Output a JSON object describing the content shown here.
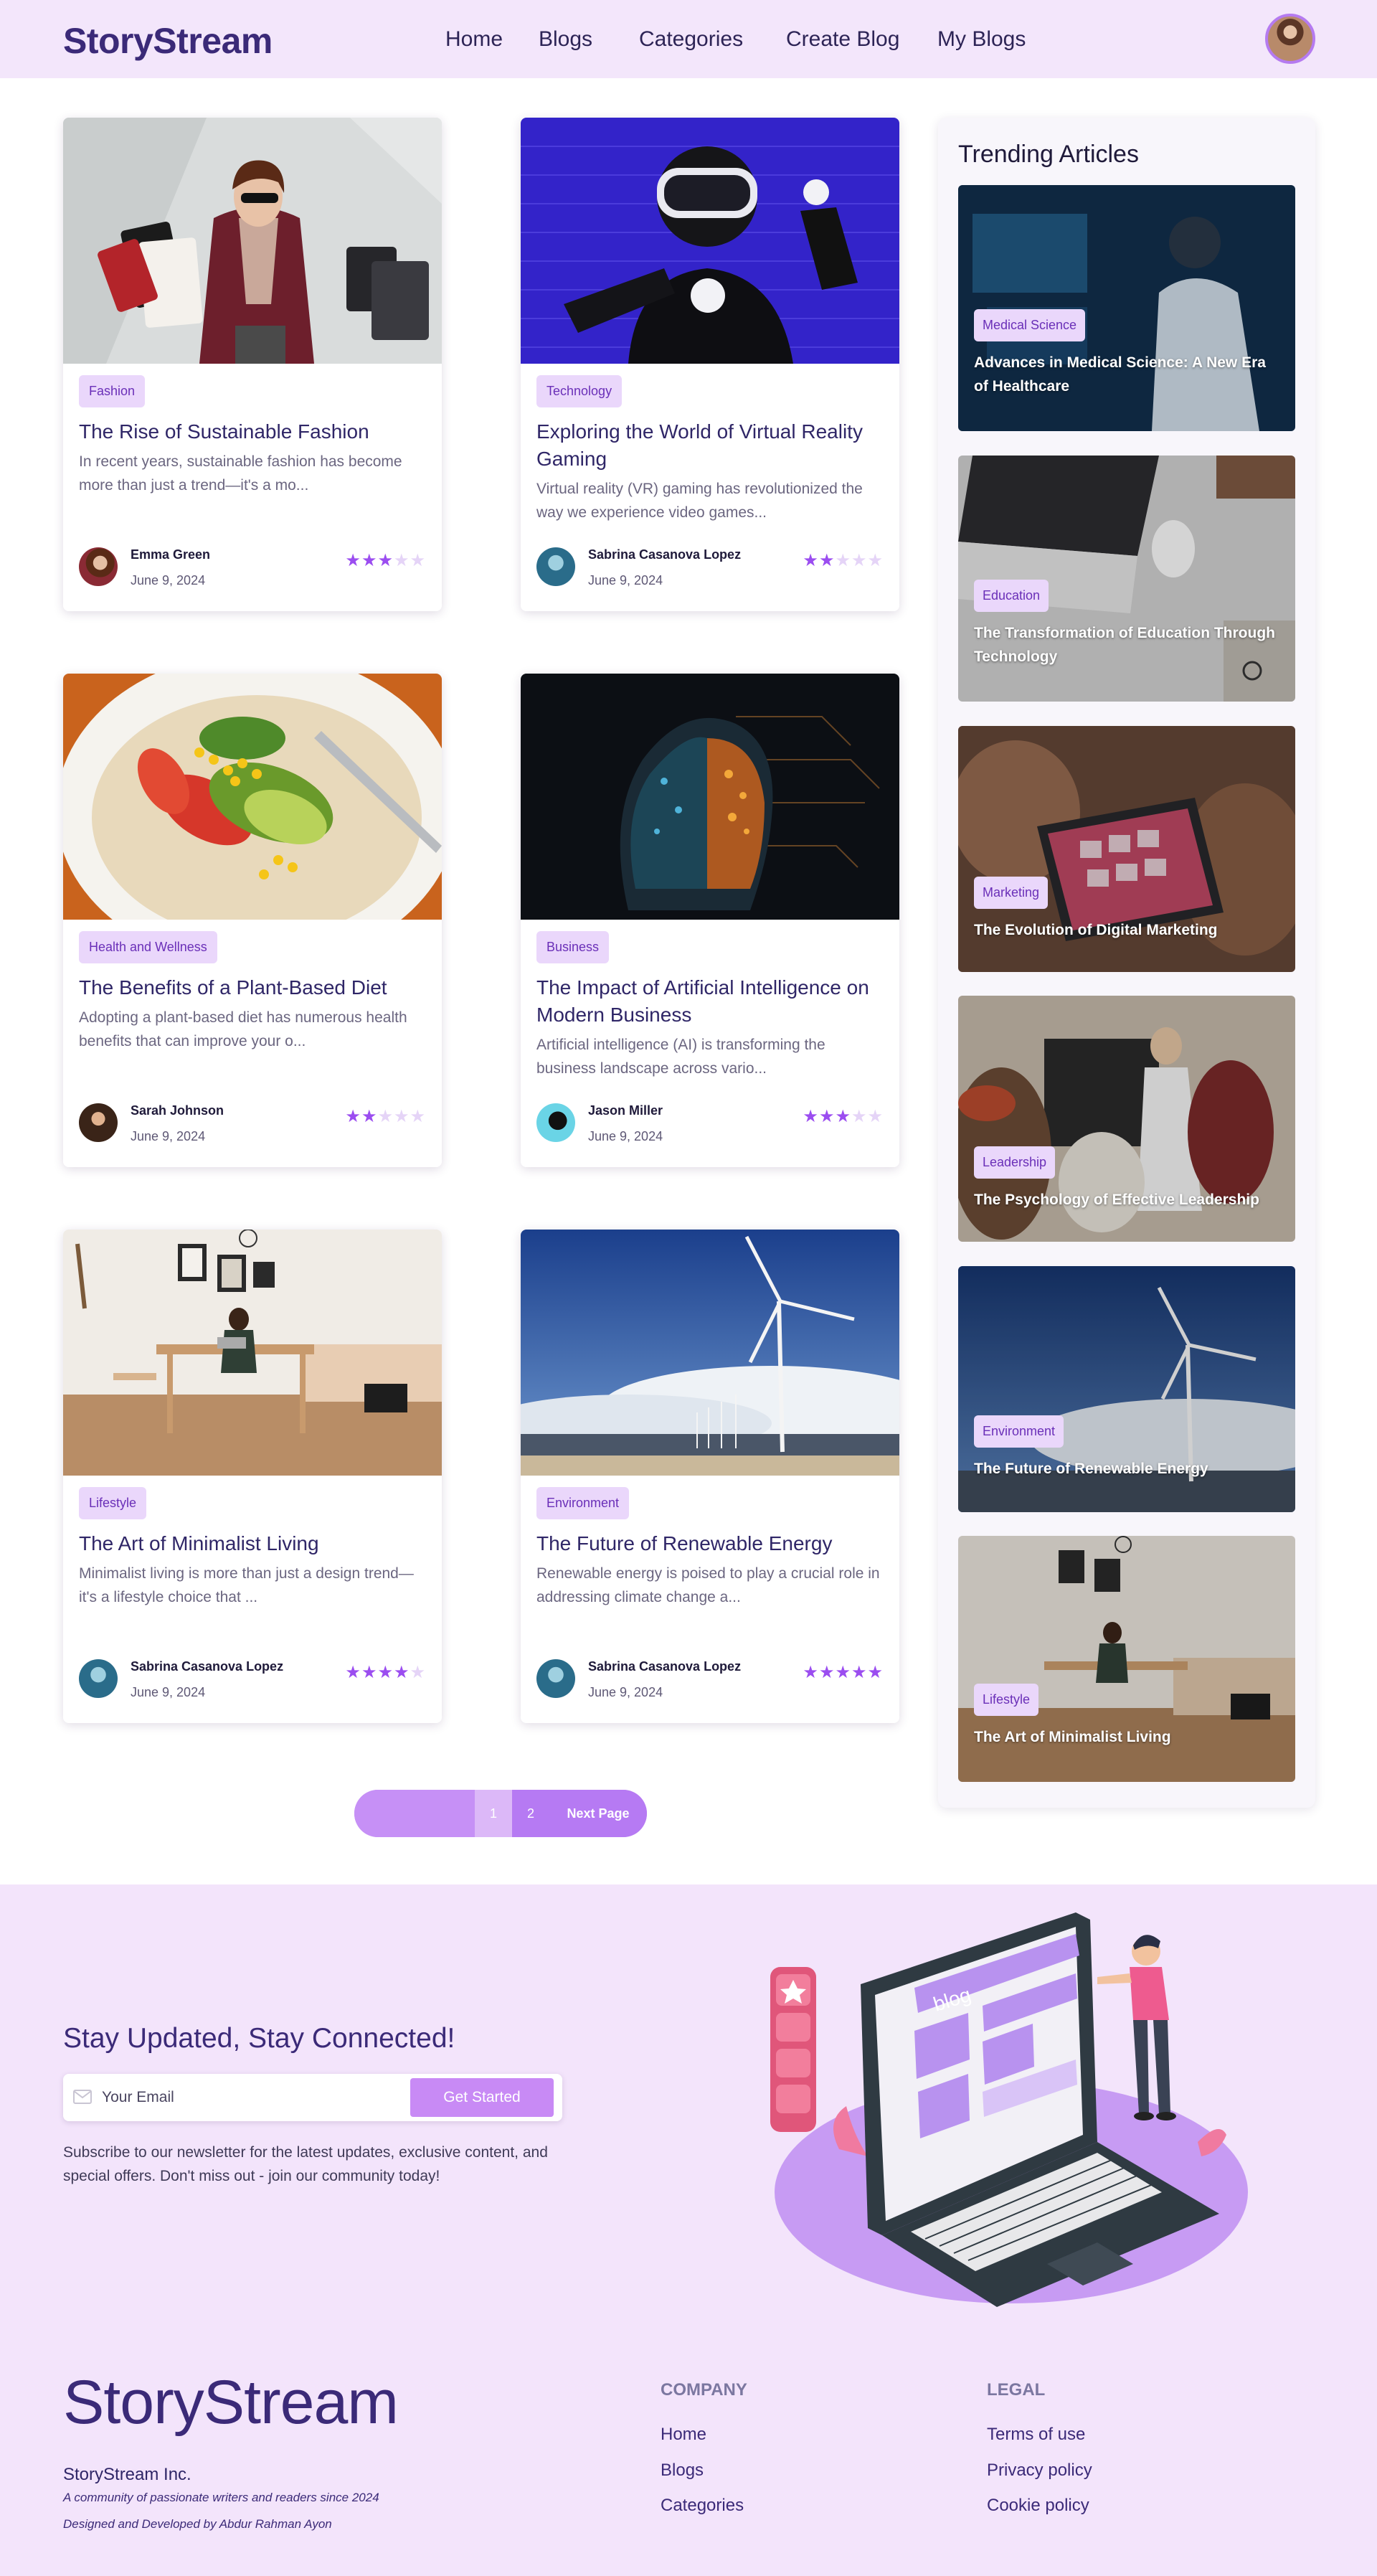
{
  "nav": {
    "logo": "StoryStream",
    "links": [
      "Home",
      "Blogs",
      "Categories",
      "Create Blog",
      "My Blogs"
    ]
  },
  "blogs": [
    {
      "category": "Fashion",
      "title": "The Rise of Sustainable Fashion",
      "excerpt": "In recent years, sustainable fashion has become more than just a trend—it's a mo...",
      "author": "Emma Green",
      "date": "June 9, 2024",
      "rating": 3
    },
    {
      "category": "Technology",
      "title": "Exploring the World of Virtual Reality Gaming",
      "excerpt": "Virtual reality (VR) gaming has revolutionized the way we experience video games...",
      "author": "Sabrina Casanova Lopez",
      "date": "June 9, 2024",
      "rating": 2
    },
    {
      "category": "Health and Wellness",
      "title": "The Benefits of a Plant-Based Diet",
      "excerpt": "Adopting a plant-based diet has numerous health benefits that can improve your o...",
      "author": "Sarah Johnson",
      "date": "June 9, 2024",
      "rating": 2
    },
    {
      "category": "Business",
      "title": "The Impact of Artificial Intelligence on Modern Business",
      "excerpt": "Artificial intelligence (AI) is transforming the business landscape across vario...",
      "author": "Jason Miller",
      "date": "June 9, 2024",
      "rating": 3
    },
    {
      "category": "Lifestyle",
      "title": "The Art of Minimalist Living",
      "excerpt": "Minimalist living is more than just a design trend—it's a lifestyle choice that ...",
      "author": "Sabrina Casanova Lopez",
      "date": "June 9, 2024",
      "rating": 4
    },
    {
      "category": "Environment",
      "title": "The Future of Renewable Energy",
      "excerpt": "Renewable energy is poised to play a crucial role in addressing climate change a...",
      "author": "Sabrina Casanova Lopez",
      "date": "June 9, 2024",
      "rating": 5
    }
  ],
  "pagination": {
    "page1": "1",
    "page2": "2",
    "next": "Next Page"
  },
  "trending": {
    "title": "Trending Articles",
    "items": [
      {
        "category": "Medical Science",
        "title": "Advances in Medical Science: A New Era of Healthcare"
      },
      {
        "category": "Education",
        "title": "The Transformation of Education Through Technology"
      },
      {
        "category": "Marketing",
        "title": "The Evolution of Digital Marketing"
      },
      {
        "category": "Leadership",
        "title": "The Psychology of Effective Leadership"
      },
      {
        "category": "Environment",
        "title": "The Future of Renewable Energy"
      },
      {
        "category": "Lifestyle",
        "title": "The Art of Minimalist Living"
      }
    ]
  },
  "newsletter": {
    "title": "Stay Updated, Stay Connected!",
    "placeholder": "Your Email",
    "button": "Get Started",
    "description": "Subscribe to our newsletter for the latest updates, exclusive content, and special offers. Don't miss out - join our community today!",
    "illustration_label": "blog"
  },
  "footer": {
    "logo": "StoryStream",
    "company": "StoryStream Inc.",
    "tagline": "A community of passionate writers and readers since 2024",
    "credit": "Designed and Developed by Abdur Rahman Ayon",
    "company_heading": "COMPANY",
    "company_links": [
      "Home",
      "Blogs",
      "Categories"
    ],
    "legal_heading": "LEGAL",
    "legal_links": [
      "Terms of use",
      "Privacy policy",
      "Cookie policy"
    ]
  },
  "colors": {
    "accent": "#b67af3",
    "brand": "#3b2a78",
    "nav_bg": "#f3e6fb",
    "badge_bg": "#ead7fb"
  }
}
